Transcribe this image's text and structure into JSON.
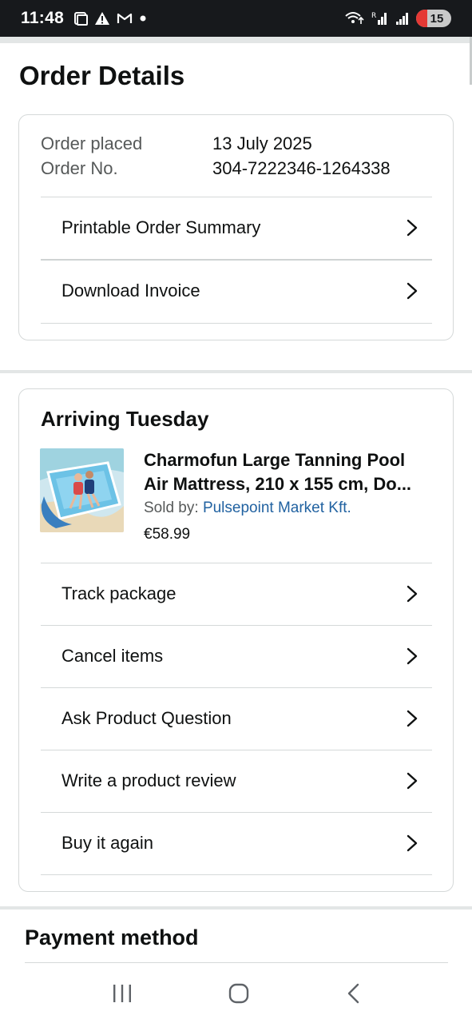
{
  "status_bar": {
    "time": "11:48",
    "battery": "15",
    "left_icons": [
      "screen-icon",
      "warning-icon",
      "gmail-icon",
      "dot-icon"
    ],
    "right_icons": [
      "wifi-calling-icon",
      "signal-r-icon",
      "signal-icon"
    ]
  },
  "page": {
    "title": "Order Details"
  },
  "order": {
    "placed_label": "Order placed",
    "placed_value": "13 July 2025",
    "number_label": "Order No.",
    "number_value": "304-7222346-1264338",
    "actions": [
      {
        "label": "Printable Order Summary"
      },
      {
        "label": "Download Invoice"
      }
    ]
  },
  "shipment": {
    "title": "Arriving Tuesday",
    "product": {
      "title_line1": "Charmofun Large Tanning Pool",
      "title_line2": "Air Mattress, 210 x 155 cm, Do...",
      "sold_by_label": "Sold by: ",
      "seller": "Pulsepoint Market Kft.",
      "price": "€58.99"
    },
    "actions": [
      {
        "label": "Track package"
      },
      {
        "label": "Cancel items"
      },
      {
        "label": "Ask Product Question"
      },
      {
        "label": "Write a product review"
      },
      {
        "label": "Buy it again"
      }
    ]
  },
  "payment": {
    "title": "Payment method"
  },
  "nav_bar": {
    "icons": [
      "recents-icon",
      "home-icon",
      "back-icon"
    ]
  },
  "colors": {
    "link": "#2162a1",
    "muted": "#565959",
    "text": "#0f1111",
    "border": "#d5d9d9"
  }
}
